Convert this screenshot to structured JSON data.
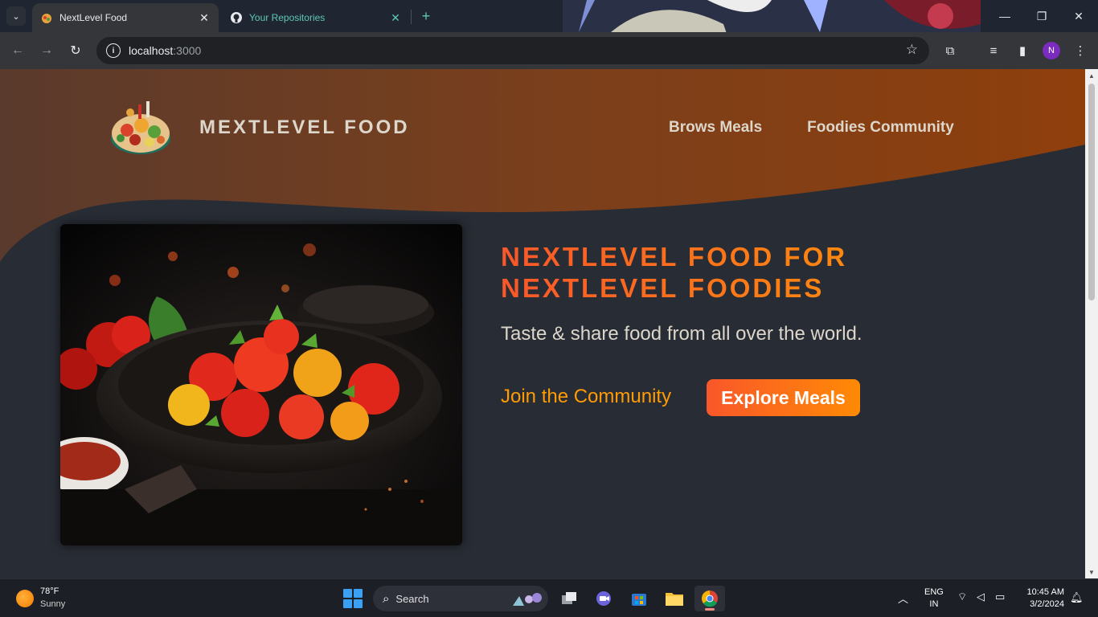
{
  "browser": {
    "tabs": [
      {
        "title": "NextLevel Food",
        "icon": "meal-favicon-icon",
        "active": true
      },
      {
        "title": "Your Repositories",
        "icon": "github-icon",
        "active": false
      }
    ],
    "new_tab_label": "+",
    "url_host": "localhost",
    "url_port": ":3000",
    "profile_initial": "N"
  },
  "site": {
    "logo_text": "MEXTLEVEL FOOD",
    "nav": [
      {
        "label": "Brows Meals"
      },
      {
        "label": "Foodies Community"
      }
    ],
    "hero": {
      "title_line1": "NEXTLEVEL FOOD FOR",
      "title_line2": "NEXTLEVEL FOODIES",
      "subtitle": "Taste & share food from all over the world.",
      "join_label": "Join the Community",
      "explore_label": "Explore Meals"
    },
    "colors": {
      "accent_start": "#f9572a",
      "accent_end": "#ff9b05",
      "page_bg": "#282c34",
      "header_wave": "#8a3f16"
    }
  },
  "taskbar": {
    "weather_temp": "78°F",
    "weather_cond": "Sunny",
    "search_label": "Search",
    "lang_top": "ENG",
    "lang_bottom": "IN",
    "time": "10:45 AM",
    "date": "3/2/2024"
  }
}
